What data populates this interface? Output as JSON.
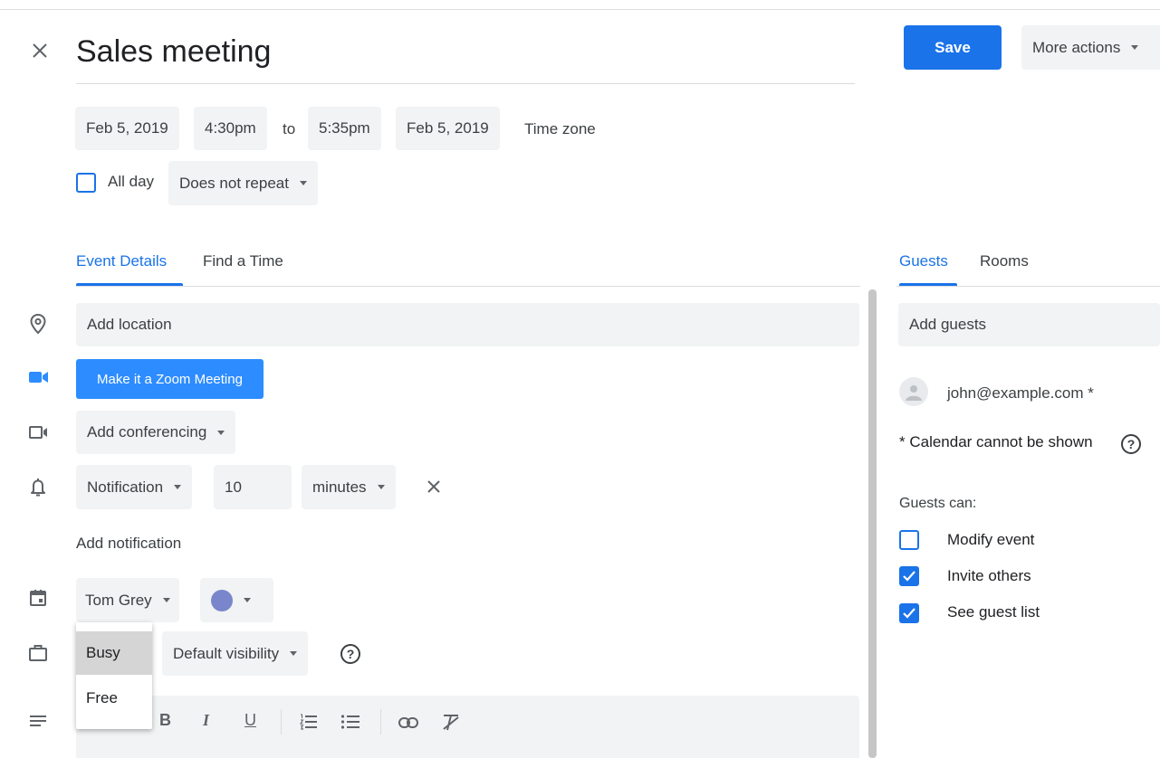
{
  "header": {
    "title": "Sales meeting",
    "save_label": "Save",
    "more_actions_label": "More actions"
  },
  "datetime": {
    "start_date": "Feb 5, 2019",
    "start_time": "4:30pm",
    "to_label": "to",
    "end_time": "5:35pm",
    "end_date": "Feb 5, 2019",
    "timezone_label": "Time zone",
    "all_day_label": "All day",
    "repeat_label": "Does not repeat"
  },
  "tabs": {
    "event_details": "Event Details",
    "find_a_time": "Find a Time"
  },
  "details": {
    "location_placeholder": "Add location",
    "zoom_button": "Make it a Zoom Meeting",
    "conferencing_label": "Add conferencing",
    "notification_type": "Notification",
    "notification_value": "10",
    "notification_unit": "minutes",
    "add_notification": "Add notification",
    "calendar_owner": "Tom Grey",
    "calendar_color": "#7986cb",
    "visibility_label": "Default visibility"
  },
  "availability_dropdown": {
    "options": [
      "Busy",
      "Free"
    ],
    "selected": "Busy"
  },
  "guests": {
    "tab_guests": "Guests",
    "tab_rooms": "Rooms",
    "add_placeholder": "Add guests",
    "guest_email": "john@example.com *",
    "calendar_note": "* Calendar cannot be shown",
    "guests_can_label": "Guests can:",
    "permissions": [
      {
        "label": "Modify event",
        "checked": false
      },
      {
        "label": "Invite others",
        "checked": true
      },
      {
        "label": "See guest list",
        "checked": true
      }
    ]
  },
  "colors": {
    "accent": "#1a73e8",
    "zoom": "#2d8cff"
  }
}
